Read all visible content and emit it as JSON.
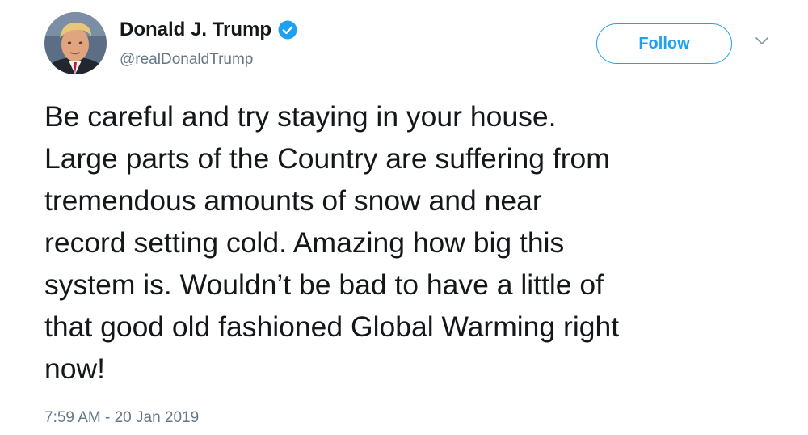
{
  "author": {
    "display_name": "Donald J. Trump",
    "handle": "@realDonaldTrump",
    "verified": true
  },
  "actions": {
    "follow_label": "Follow",
    "menu_icon": "chevron-down-icon"
  },
  "tweet": {
    "lines": [
      "Be careful and try staying in your house.",
      "Large parts of the Country are suffering from",
      "tremendous amounts of snow and near",
      "record setting cold. Amazing how big this",
      "system is. Wouldn’t be bad to have a little of",
      "that good old fashioned Global Warming right",
      "now!"
    ],
    "timestamp": "7:59 AM - 20 Jan 2019"
  },
  "colors": {
    "accent": "#1da1f2",
    "text": "#14171a",
    "secondary_text": "#657786",
    "background": "#ffffff"
  }
}
